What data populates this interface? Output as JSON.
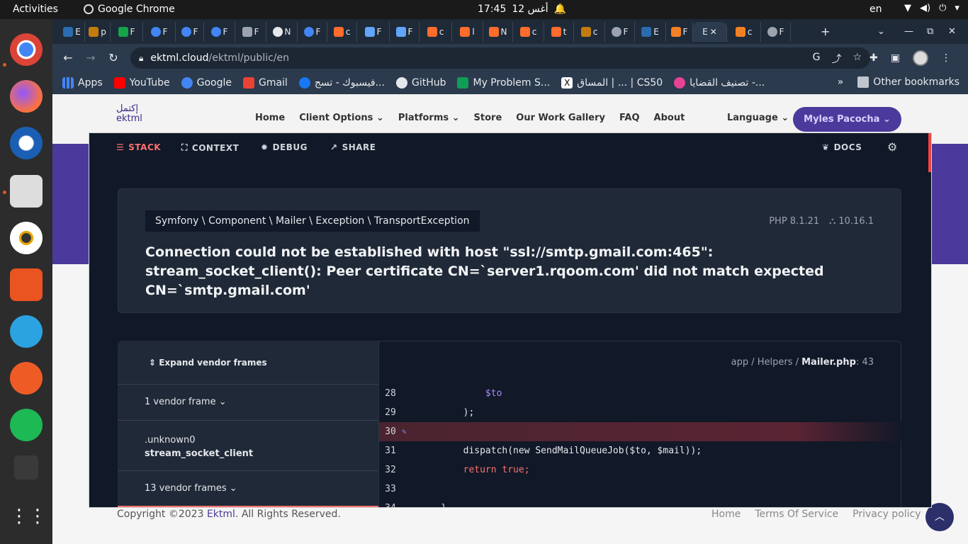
{
  "topbar": {
    "activities": "Activities",
    "app_name": "Google Chrome",
    "time": "17:45",
    "date": "12 أغس",
    "lang": "en"
  },
  "browser": {
    "tabs": [
      {
        "letter": "E"
      },
      {
        "letter": "p"
      },
      {
        "letter": "F"
      },
      {
        "letter": "F"
      },
      {
        "letter": "F"
      },
      {
        "letter": "F"
      },
      {
        "letter": "F"
      },
      {
        "letter": "N"
      },
      {
        "letter": "F"
      },
      {
        "letter": "c"
      },
      {
        "letter": "F"
      },
      {
        "letter": "F"
      },
      {
        "letter": "c"
      },
      {
        "letter": "l"
      },
      {
        "letter": "N"
      },
      {
        "letter": "c"
      },
      {
        "letter": "t"
      },
      {
        "letter": "c"
      },
      {
        "letter": "F"
      },
      {
        "letter": "E"
      },
      {
        "letter": "F"
      },
      {
        "letter": "c"
      },
      {
        "letter": "F"
      }
    ],
    "active_tab": {
      "letter": "E"
    },
    "url_host": "ektml.cloud",
    "url_path": "/ektml/public/en",
    "bookmarks": [
      {
        "label": "Apps"
      },
      {
        "label": "YouTube"
      },
      {
        "label": "Google"
      },
      {
        "label": "Gmail"
      },
      {
        "label": "فيسبوك - تسج..."
      },
      {
        "label": "GitHub"
      },
      {
        "label": "My Problem S..."
      },
      {
        "label": "المساق | ... | CS50"
      },
      {
        "label": "تصنيف القضايا -..."
      }
    ],
    "other_bookmarks": "Other bookmarks"
  },
  "site": {
    "logo_ar": "إكتمل",
    "logo_en": "ektml",
    "nav": [
      "Home",
      "Client Options",
      "Platforms",
      "Store",
      "Our Work Gallery",
      "FAQ",
      "About"
    ],
    "language": "Language",
    "user": "Myles Pacocha",
    "footer_copy_prefix": "Copyright ©2023 ",
    "footer_brand": "Ektml",
    "footer_copy_suffix": ". All Rights Reserved.",
    "footer_links": [
      "Home",
      "Terms Of Service",
      "Privacy policy"
    ]
  },
  "error": {
    "tabs": [
      "STACK",
      "CONTEXT",
      "DEBUG",
      "SHARE"
    ],
    "docs": "DOCS",
    "exception_class": "Symfony \\ Component \\ Mailer \\ Exception \\ TransportException",
    "php_version": "PHP 8.1.21",
    "laravel_version": "10.16.1",
    "message": "Connection could not be established with host \"ssl://smtp.gmail.com:465\": stream_socket_client(): Peer certificate CN=`server1.rqoom.com' did not match expected CN=`smtp.gmail.com'",
    "expand_vendor": "Expand vendor frames",
    "frames": [
      {
        "label": "1 vendor frame"
      },
      {
        "file": ".unknown0",
        "func": "stream_socket_client"
      },
      {
        "label": "13 vendor frames"
      }
    ],
    "file_path_prefix": "app / Helpers / ",
    "file_name": "Mailer.php",
    "file_line": ": 43",
    "code_lines": [
      {
        "num": "28",
        "text": "            $to"
      },
      {
        "num": "29",
        "text": "        );"
      },
      {
        "num": "30",
        "text": ""
      },
      {
        "num": "31",
        "text": "        dispatch(new SendMailQueueJob($to, $mail));"
      },
      {
        "num": "32",
        "text": "        return true;"
      },
      {
        "num": "33",
        "text": ""
      },
      {
        "num": "34",
        "text": "    }"
      }
    ]
  },
  "colors": {
    "accent": "#4b3a9b",
    "error_red": "#f87171",
    "modal_bg": "#111827"
  }
}
